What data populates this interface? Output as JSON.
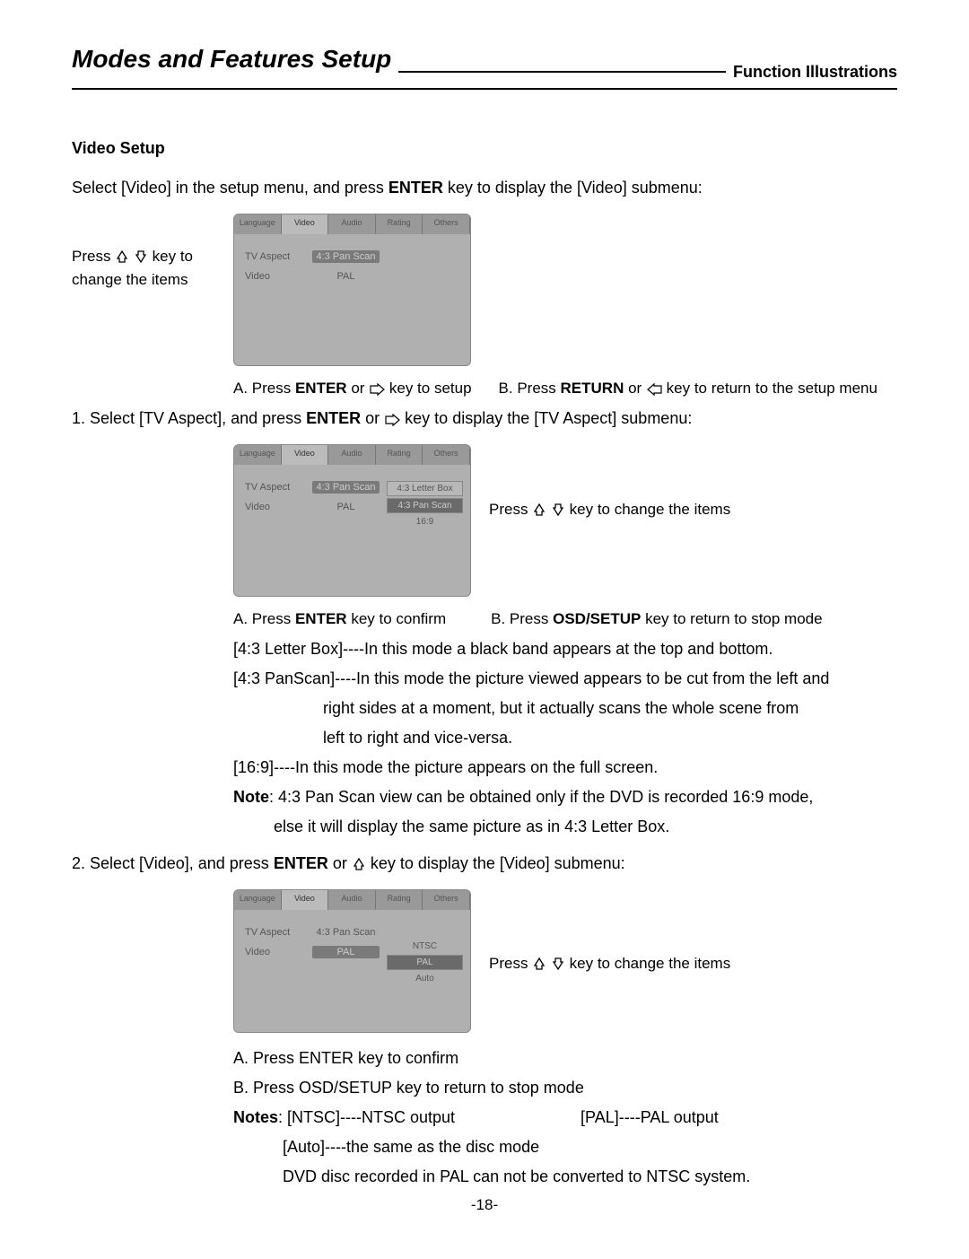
{
  "header": {
    "title": "Modes and Features Setup",
    "subtitle": "Function Illustrations"
  },
  "section_title": "Video Setup",
  "intro": "Select [Video] in the setup menu, and press ",
  "intro_bold": "ENTER",
  "intro2": " key to display the [Video] submenu:",
  "caption_left1a": "Press ",
  "caption_left1b": " key to change the items",
  "osd1": {
    "tabs": [
      "Language",
      "Video",
      "Audio",
      "Rating",
      "Others"
    ],
    "row1_label": "TV Aspect",
    "row1_val": "4:3 Pan Scan",
    "row2_label": "Video",
    "row2_val": "PAL"
  },
  "ab1a": "A. Press ",
  "ab1a_bold": "ENTER",
  "ab1a2": " or ",
  "ab1a3": " key to setup",
  "ab1b": "B. Press ",
  "ab1b_bold": "RETURN",
  "ab1b2": " or ",
  "ab1b3": " key to return to the setup menu",
  "num1a": "1. Select [TV Aspect], and press ",
  "num1a_bold": "ENTER",
  "num1a2": " or ",
  "num1a3": " key to display the [TV Aspect] submenu:",
  "osd2": {
    "tabs": [
      "Language",
      "Video",
      "Audio",
      "Rating",
      "Others"
    ],
    "row1_label": "TV Aspect",
    "row1_val": "4:3 Pan Scan",
    "row2_label": "Video",
    "row2_val": "PAL",
    "sub": [
      "4:3 Letter Box",
      "4:3 Pan Scan",
      "16:9"
    ]
  },
  "caption_right2": "Press ",
  "caption_right2b": " key to change the items",
  "ab2a": "A. Press ",
  "ab2a_bold": "ENTER",
  "ab2a2": " key to confirm",
  "ab2b": "B. Press ",
  "ab2b_bold": "OSD/SETUP",
  "ab2b2": " key to return to stop mode",
  "desc_lb": "[4:3 Letter Box]----In this mode a black band appears at the top and bottom.",
  "desc_ps1": "[4:3 PanScan]----In this mode the picture viewed appears to be cut from the left and",
  "desc_ps2": "right sides at a moment, but it actually scans the whole scene from",
  "desc_ps3": "left to right and vice-versa.",
  "desc_169": "[16:9]----In this mode the picture appears on the full screen.",
  "note_bold": "Note",
  "note1": ": 4:3 Pan Scan view can be obtained only if the DVD is recorded 16:9 mode,",
  "note2": "else it will display the same picture as in 4:3 Letter Box.",
  "num2a": "2. Select [Video], and press ",
  "num2a_bold": "ENTER",
  "num2a2": " or ",
  "num2a3": " key to display the [Video] submenu:",
  "osd3": {
    "tabs": [
      "Language",
      "Video",
      "Audio",
      "Rating",
      "Others"
    ],
    "row1_label": "TV Aspect",
    "row1_val": "4:3 Pan Scan",
    "row2_label": "Video",
    "row2_val": "PAL",
    "sub": [
      "NTSC",
      "PAL",
      "Auto"
    ]
  },
  "caption_right3": "Press ",
  "caption_right3b": " key to change the items",
  "end_a": "A. Press ENTER key to confirm",
  "end_b": "B. Press OSD/SETUP key to return to stop mode",
  "notes_bold": "Notes",
  "notes1": ": [NTSC]----NTSC output",
  "notes2": "[PAL]----PAL output",
  "notes3": "[Auto]----the same as the disc mode",
  "notes4": "DVD disc recorded in PAL can not be converted to NTSC system.",
  "page_num": "-18-"
}
